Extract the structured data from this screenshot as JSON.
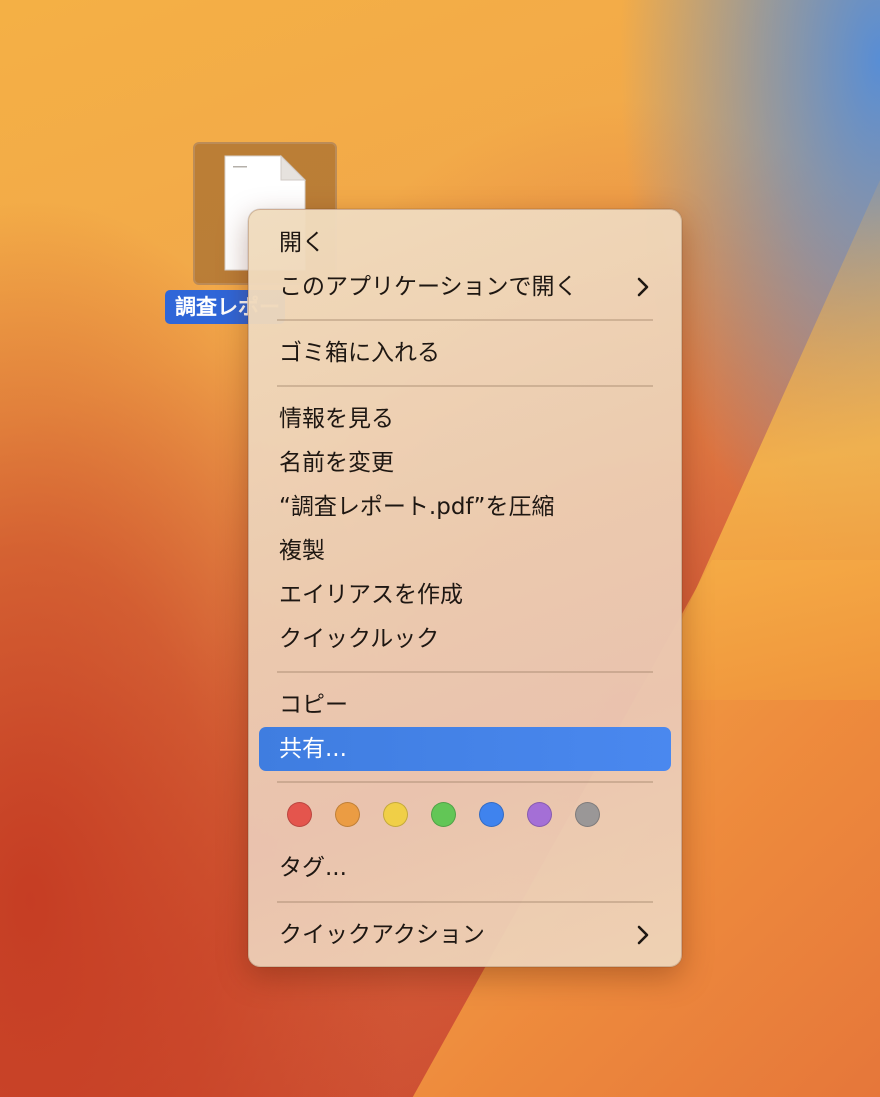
{
  "desktop": {
    "file": {
      "label": "調査レポート.pdf"
    }
  },
  "context_menu": {
    "items": [
      {
        "label": "開く"
      },
      {
        "label": "このアプリケーションで開く",
        "has_submenu": true
      },
      {
        "label": "ゴミ箱に入れる"
      },
      {
        "label": "情報を見る"
      },
      {
        "label": "名前を変更"
      },
      {
        "label": "“調査レポート.pdf”を圧縮"
      },
      {
        "label": "複製"
      },
      {
        "label": "エイリアスを作成"
      },
      {
        "label": "クイックルック"
      },
      {
        "label": "コピー"
      },
      {
        "label": "共有...",
        "selected": true
      },
      {
        "label": "タグ..."
      },
      {
        "label": "クイックアクション",
        "has_submenu": true
      }
    ],
    "tags": [
      {
        "name": "red",
        "color": "#e4554d"
      },
      {
        "name": "orange",
        "color": "#eb9c43"
      },
      {
        "name": "yellow",
        "color": "#f0cf47"
      },
      {
        "name": "green",
        "color": "#62c656"
      },
      {
        "name": "blue",
        "color": "#3f83ee"
      },
      {
        "name": "purple",
        "color": "#a46fd6"
      },
      {
        "name": "gray",
        "color": "#9a9797"
      }
    ],
    "icons": {
      "submenu": "chevron-right-icon"
    }
  }
}
